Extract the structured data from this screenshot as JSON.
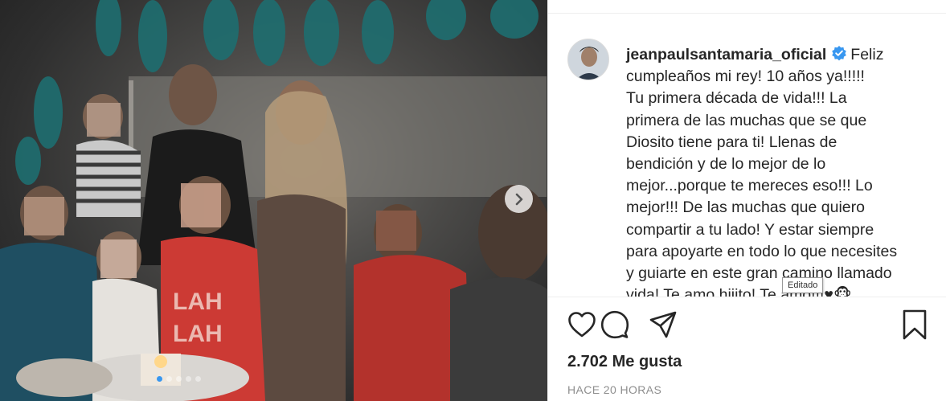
{
  "post": {
    "username": "jeanpaulsantamaria_oficial",
    "caption_lines": [
      "Feliz",
      "cumpleaños mi rey! 10 años ya!!!!!",
      "Tu primera década de vida!!! La",
      "primera de las muchas que se que",
      "Diosito tiene para ti! Llenas de",
      "bendición y de lo mejor de lo",
      "mejor...porque te mereces eso!!! Lo",
      "mejor!!! De las muchas que quiero",
      "compartir a tu lado! Y estar siempre",
      "para apoyarte en todo lo que necesites",
      "y guiarte en este gran camino llamado",
      "vida! Te amo hijito! Te amo!!!♥🐵"
    ],
    "edited_tooltip": "Editado",
    "likes": "2.702 Me gusta",
    "timestamp": "HACE 20 HORAS"
  },
  "carousel": {
    "slide_count": 5,
    "active_index": 0
  },
  "colors": {
    "verified": "#3897f0",
    "active_dot": "#3897f0",
    "text": "#262626",
    "muted": "#8e8e8e"
  },
  "icons": {
    "like": "heart-icon",
    "comment": "comment-icon",
    "share": "paper-plane-icon",
    "save": "bookmark-icon",
    "next": "chevron-right-icon",
    "verified": "verified-badge-icon"
  }
}
